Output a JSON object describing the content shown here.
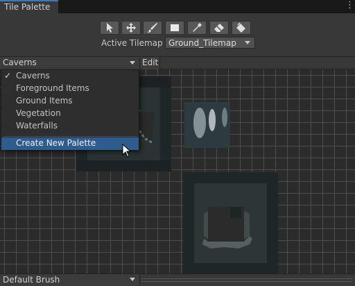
{
  "window": {
    "tab_title": "Tile Palette",
    "menu_glyph": "⋮"
  },
  "toolbar": {
    "tools": [
      {
        "name": "select-tool",
        "icon": "arrow-cursor-icon"
      },
      {
        "name": "move-tool",
        "icon": "move-arrows-icon"
      },
      {
        "name": "paint-tool",
        "icon": "brush-icon"
      },
      {
        "name": "box-fill-tool",
        "icon": "rectangle-icon"
      },
      {
        "name": "pick-tool",
        "icon": "eyedropper-icon"
      },
      {
        "name": "erase-tool",
        "icon": "eraser-icon"
      },
      {
        "name": "fill-tool",
        "icon": "paint-bucket-icon"
      }
    ],
    "active_tilemap_label": "Active Tilemap",
    "active_tilemap_value": "Ground_Tilemap"
  },
  "palette_bar": {
    "selected": "Caverns",
    "edit_label": "Edit"
  },
  "palette_menu": {
    "items": [
      {
        "label": "Caverns",
        "checked": true
      },
      {
        "label": "Foreground Items",
        "checked": false
      },
      {
        "label": "Ground Items",
        "checked": false
      },
      {
        "label": "Vegetation",
        "checked": false
      },
      {
        "label": "Waterfalls",
        "checked": false
      }
    ],
    "check_glyph": "✓",
    "create_label": "Create New Palette"
  },
  "brush_bar": {
    "selected": "Default Brush"
  },
  "colors": {
    "accent": "#3a79bb",
    "menu_highlight": "#2e5c8f",
    "panel": "#383838",
    "grid_bg": "#2b2b2b"
  }
}
